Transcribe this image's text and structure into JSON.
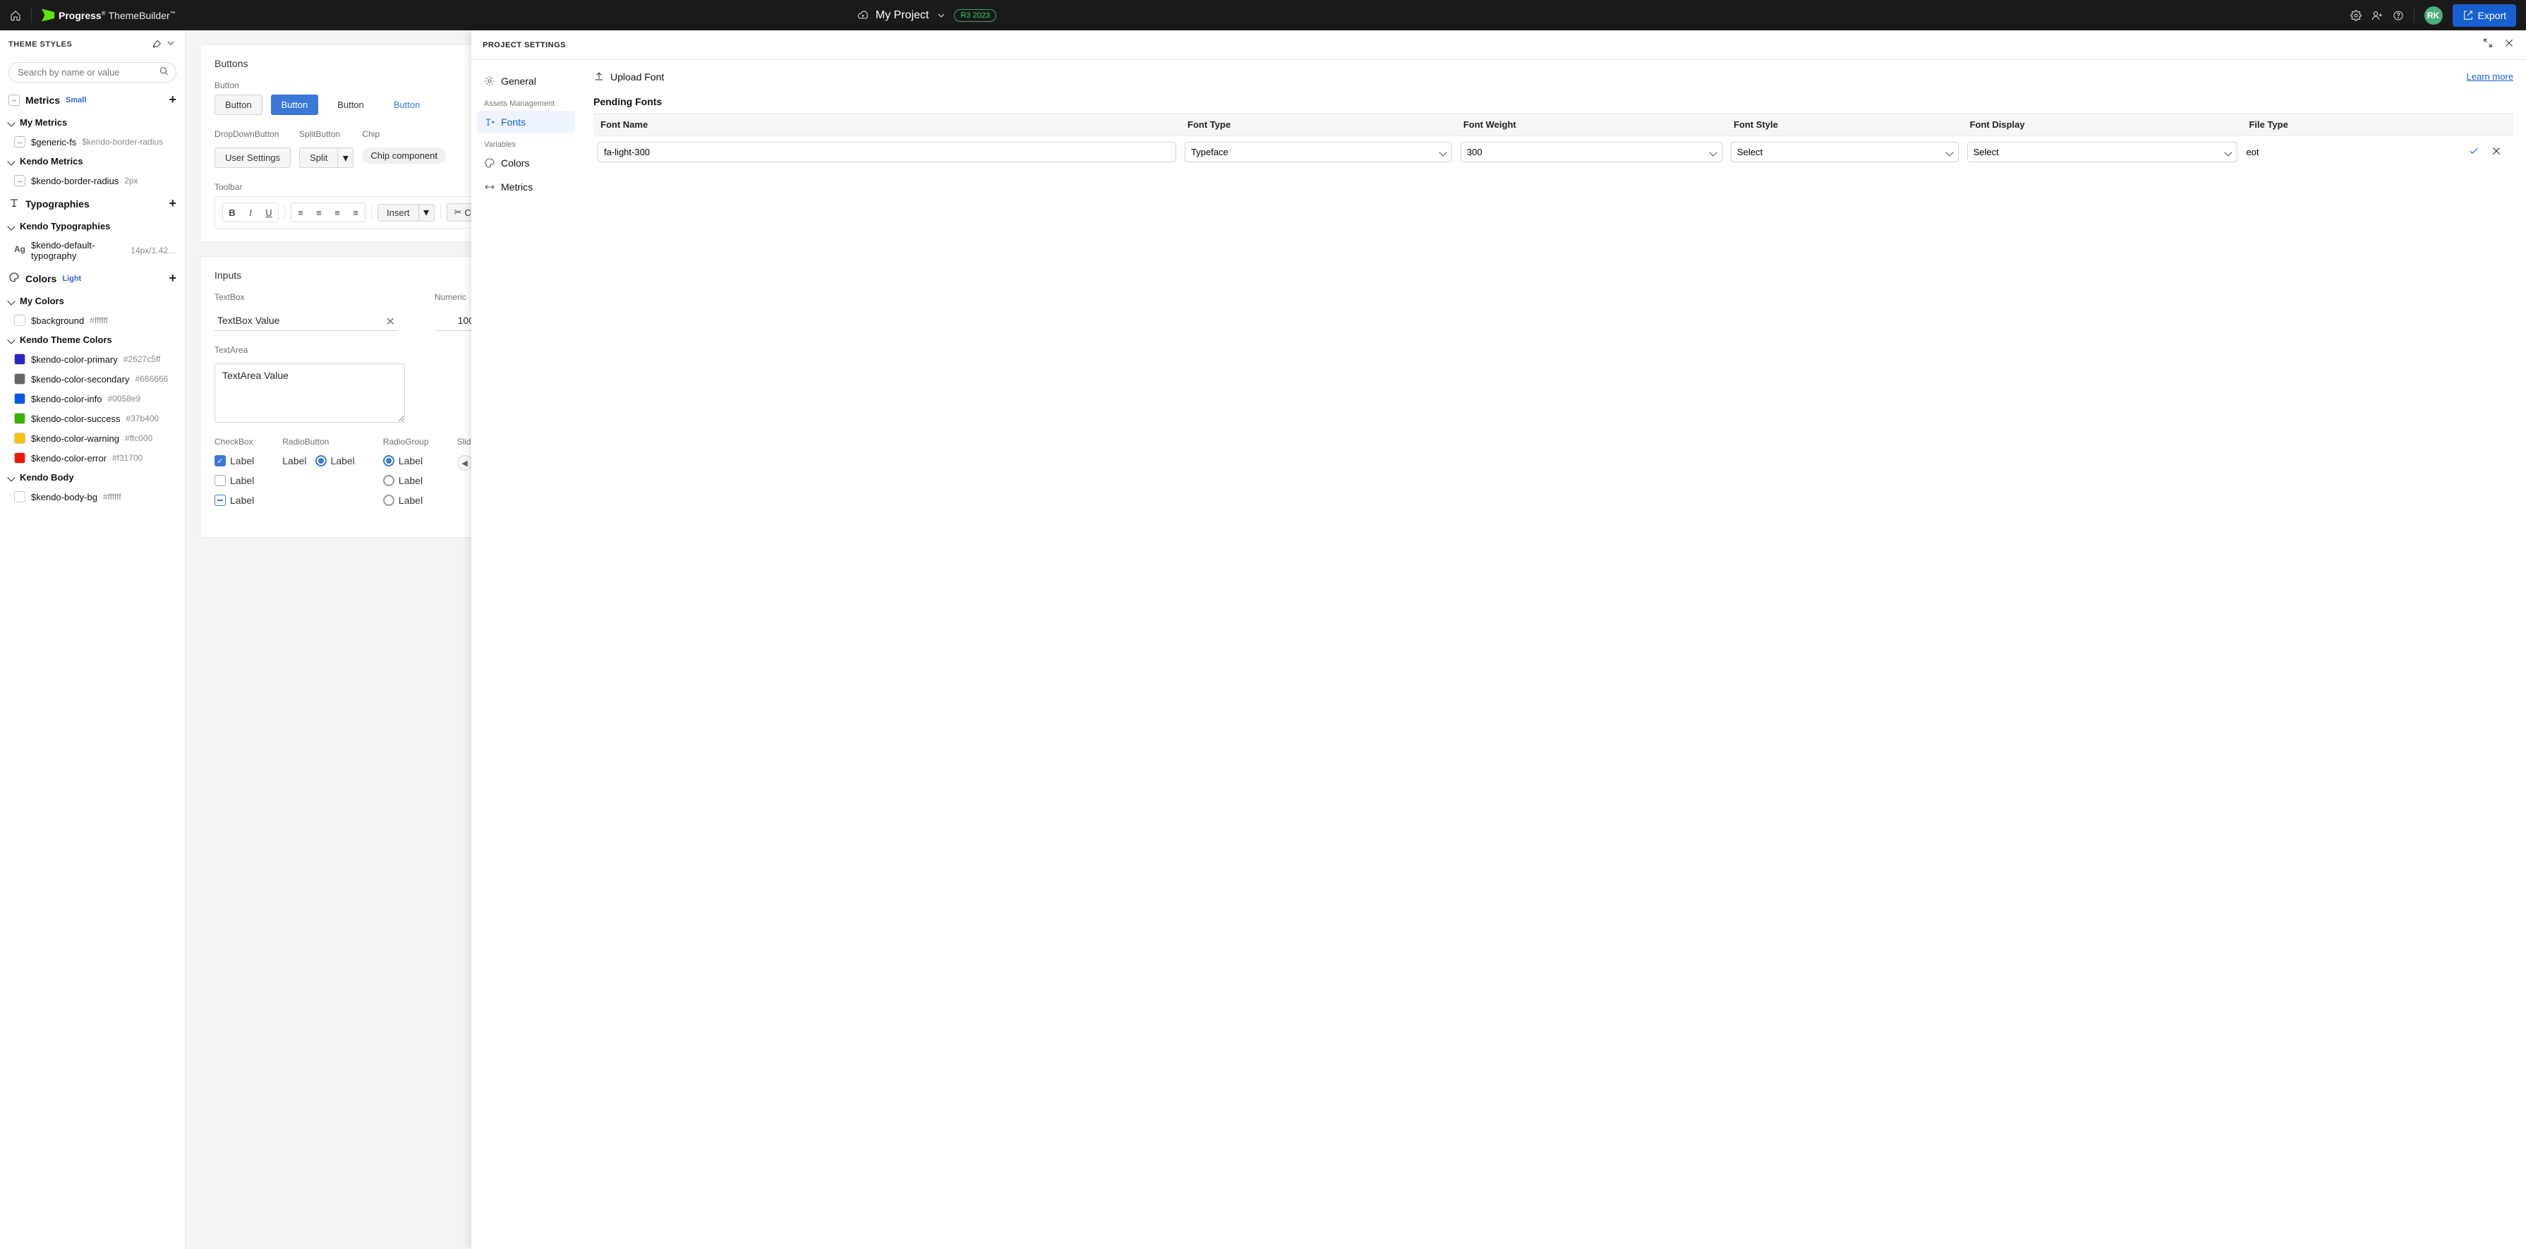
{
  "topbar": {
    "brand_strong": "Progress",
    "brand_light": "ThemeBuilder",
    "project_name": "My Project",
    "version": "R3 2023",
    "avatar": "RK",
    "export_label": "Export"
  },
  "sidebar": {
    "title": "THEME STYLES",
    "search_placeholder": "Search by name or value",
    "sections": {
      "metrics": {
        "label": "Metrics",
        "badge": "Small"
      },
      "my_metrics_title": "My Metrics",
      "generic_fs": {
        "name": "$generic-fs",
        "meta": "$kendo-border-radius"
      },
      "kendo_metrics_title": "Kendo Metrics",
      "kendo_border_radius": {
        "name": "$kendo-border-radius",
        "meta": "2px"
      },
      "typographies": {
        "label": "Typographies"
      },
      "kendo_typographies_title": "Kendo Typographies",
      "default_typography": {
        "name": "$kendo-default-typography",
        "meta": "14px/1.42…"
      },
      "colors": {
        "label": "Colors",
        "badge": "Light"
      },
      "my_colors_title": "My Colors",
      "background": {
        "name": "$background",
        "meta": "#ffffff",
        "hex": "#ffffff"
      },
      "kendo_theme_colors_title": "Kendo Theme Colors",
      "theme_colors": [
        {
          "name": "$kendo-color-primary",
          "meta": "#2627c5ff",
          "hex": "#2627c5"
        },
        {
          "name": "$kendo-color-secondary",
          "meta": "#666666",
          "hex": "#666666"
        },
        {
          "name": "$kendo-color-info",
          "meta": "#0058e9",
          "hex": "#0058e9"
        },
        {
          "name": "$kendo-color-success",
          "meta": "#37b400",
          "hex": "#37b400"
        },
        {
          "name": "$kendo-color-warning",
          "meta": "#ffc000",
          "hex": "#ffc000"
        },
        {
          "name": "$kendo-color-error",
          "meta": "#f31700",
          "hex": "#f31700"
        }
      ],
      "kendo_body_title": "Kendo Body",
      "body_bg": {
        "name": "$kendo-body-bg",
        "meta": "#ffffff",
        "hex": "#ffffff"
      }
    }
  },
  "canvas": {
    "buttons_title": "Buttons",
    "button_lbl": "Button",
    "btn1": "Button",
    "btn2": "Button",
    "btn3": "Button",
    "btn4": "Button",
    "ddb_lbl": "DropDownButton",
    "ddb_btn": "User Settings",
    "split_lbl": "SplitButton",
    "split_btn": "Split",
    "chip_lbl": "Chip",
    "chip_text": "Chip component",
    "toolbar_lbl": "Toolbar",
    "insert": "Insert",
    "cut": "Cut",
    "inputs_title": "Inputs",
    "textbox_lbl": "TextBox",
    "textbox_val": "TextBox Value",
    "numeric_lbl": "Numeric",
    "numeric_val": "100",
    "textarea_lbl": "TextArea",
    "textarea_val": "TextArea Value",
    "checkbox_lbl": "CheckBox",
    "cb_label": "Label",
    "radiobutton_lbl": "RadioButton",
    "rb_label": "Label",
    "radiogroup_lbl": "RadioGroup",
    "slider_lbl": "Slider /"
  },
  "panel": {
    "title": "PROJECT SETTINGS",
    "nav": {
      "general": "General",
      "assets_section": "Assets Management",
      "fonts": "Fonts",
      "variables_section": "Variables",
      "colors": "Colors",
      "metrics": "Metrics"
    },
    "upload_label": "Upload Font",
    "learn_more": "Learn more",
    "pending_title": "Pending Fonts",
    "columns": {
      "name": "Font Name",
      "type": "Font Type",
      "weight": "Font Weight",
      "style": "Font Style",
      "display": "Font Display",
      "file": "File Type"
    },
    "row": {
      "name": "fa-light-300",
      "type": "Typeface",
      "weight": "300",
      "style": "Select",
      "display": "Select",
      "file": "eot"
    }
  }
}
